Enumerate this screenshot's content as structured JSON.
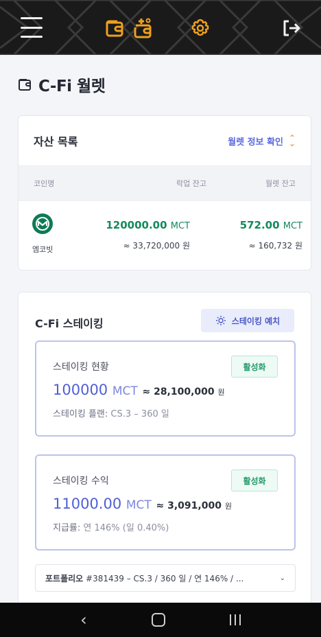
{
  "header": {
    "icons": [
      "menu-icon",
      "wallet-icon",
      "wallet-add-icon",
      "gear-icon",
      "logout-icon"
    ],
    "accent": "#f0a020"
  },
  "page": {
    "title": "C-Fi 월렛"
  },
  "assets": {
    "title": "자산 목록",
    "info_link": "월렛 정보 확인",
    "columns": {
      "coin": "코인명",
      "locked": "락업 잔고",
      "wallet": "월렛 잔고"
    },
    "rows": [
      {
        "coin_name": "엠코빗",
        "locked_amount": "120000.00",
        "locked_unit": "MCT",
        "locked_krw": "≈ 33,720,000 원",
        "wallet_amount": "572.00",
        "wallet_unit": "MCT",
        "wallet_krw": "≈ 160,732 원"
      }
    ]
  },
  "staking": {
    "title": "C-Fi 스테이킹",
    "deposit_button": "스테이킹 예치",
    "status_box": {
      "label": "스테이킹 현황",
      "badge": "활성화",
      "value": "100000",
      "unit": "MCT",
      "krw": "≈ 28,100,000",
      "krw_unit": "원",
      "sub_label": "스테이킹 플랜:",
      "sub_value": "CS.3 – 360 일"
    },
    "income_box": {
      "label": "스테이킹 수익",
      "badge": "활성화",
      "value": "11000.00",
      "unit": "MCT",
      "krw": "≈ 3,091,000",
      "krw_unit": "원",
      "sub_label": "지급률:",
      "sub_value": "연 146% (일 0.40%)"
    },
    "portfolio": {
      "label": "포트폴리오",
      "value": "#381439 – CS.3 / 360 일 / 연 146% / ..."
    }
  },
  "colors": {
    "topbar": "#1a1a1a",
    "link": "#5b6be0",
    "positive": "#138a5a",
    "badge": "#1f9a66"
  }
}
